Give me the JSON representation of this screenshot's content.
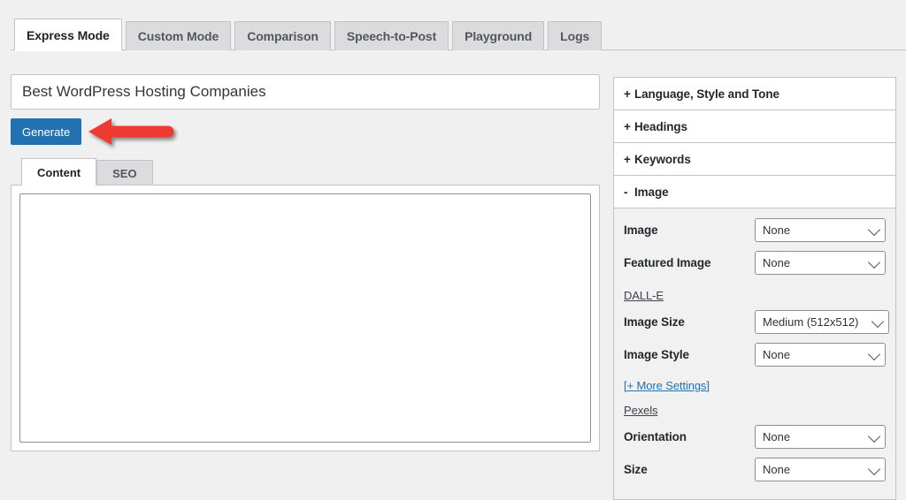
{
  "app": {
    "accent_blue": "#2271b1",
    "annotation_color": "#ee3b33",
    "page_bg": "#f0f0f1"
  },
  "tabs": [
    {
      "label": "Express Mode",
      "active": true
    },
    {
      "label": "Custom Mode",
      "active": false
    },
    {
      "label": "Comparison",
      "active": false
    },
    {
      "label": "Speech-to-Post",
      "active": false
    },
    {
      "label": "Playground",
      "active": false
    },
    {
      "label": "Logs",
      "active": false
    }
  ],
  "main": {
    "title_input": {
      "value": "Best WordPress Hosting Companies",
      "placeholder": "Title"
    },
    "generate_label": "Generate",
    "content_tabs": [
      {
        "label": "Content",
        "active": true
      },
      {
        "label": "SEO",
        "active": false
      }
    ],
    "editor": {
      "value": "",
      "placeholder": ""
    }
  },
  "sidebar": {
    "sections": [
      {
        "sign": "+",
        "label": "Language, Style and Tone",
        "expanded": false
      },
      {
        "sign": "+",
        "label": "Headings",
        "expanded": false
      },
      {
        "sign": "+",
        "label": "Keywords",
        "expanded": false
      },
      {
        "sign": "-",
        "label": "Image",
        "expanded": true
      }
    ],
    "image_panel": {
      "fields": [
        {
          "label": "Image",
          "value": "None"
        },
        {
          "label": "Featured Image",
          "value": "None"
        }
      ],
      "dalle": {
        "link_label": "DALL-E",
        "fields": [
          {
            "label": "Image Size",
            "value": "Medium (512x512)"
          },
          {
            "label": "Image Style",
            "value": "None"
          }
        ],
        "more_settings_label": "[+ More Settings]"
      },
      "pexels": {
        "link_label": "Pexels",
        "fields": [
          {
            "label": "Orientation",
            "value": "None"
          },
          {
            "label": "Size",
            "value": "None"
          }
        ]
      }
    }
  }
}
